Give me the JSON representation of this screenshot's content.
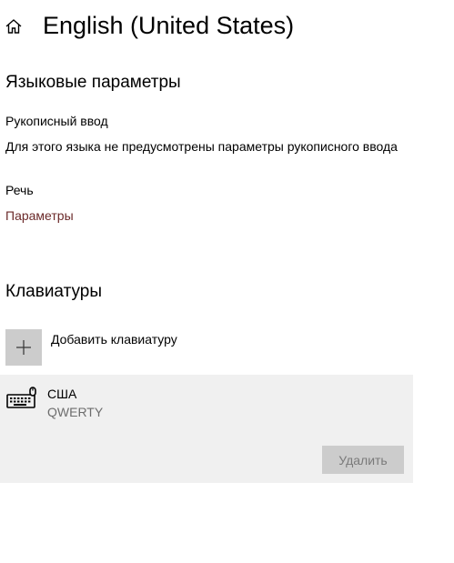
{
  "header": {
    "home_icon": "home-icon",
    "title": "English (United States)"
  },
  "language_options": {
    "section_title": "Языковые параметры",
    "handwriting": {
      "label": "Рукописный ввод",
      "description": "Для этого языка не предусмотрены параметры рукописного ввода"
    },
    "speech": {
      "label": "Речь",
      "link": "Параметры"
    }
  },
  "keyboards": {
    "section_title": "Клавиатуры",
    "add_label": "Добавить клавиатуру",
    "add_icon": "plus-icon",
    "items": [
      {
        "name": "США",
        "layout": "QWERTY",
        "icon": "keyboard-icon",
        "remove_label": "Удалить",
        "remove_enabled": false
      }
    ]
  },
  "colors": {
    "link": "#6b2a2a",
    "selected_item_bg": "#f0f0f0",
    "button_bg": "#cccccc",
    "disabled_text": "#7a7a7a",
    "secondary_text": "#6d6d6d"
  }
}
